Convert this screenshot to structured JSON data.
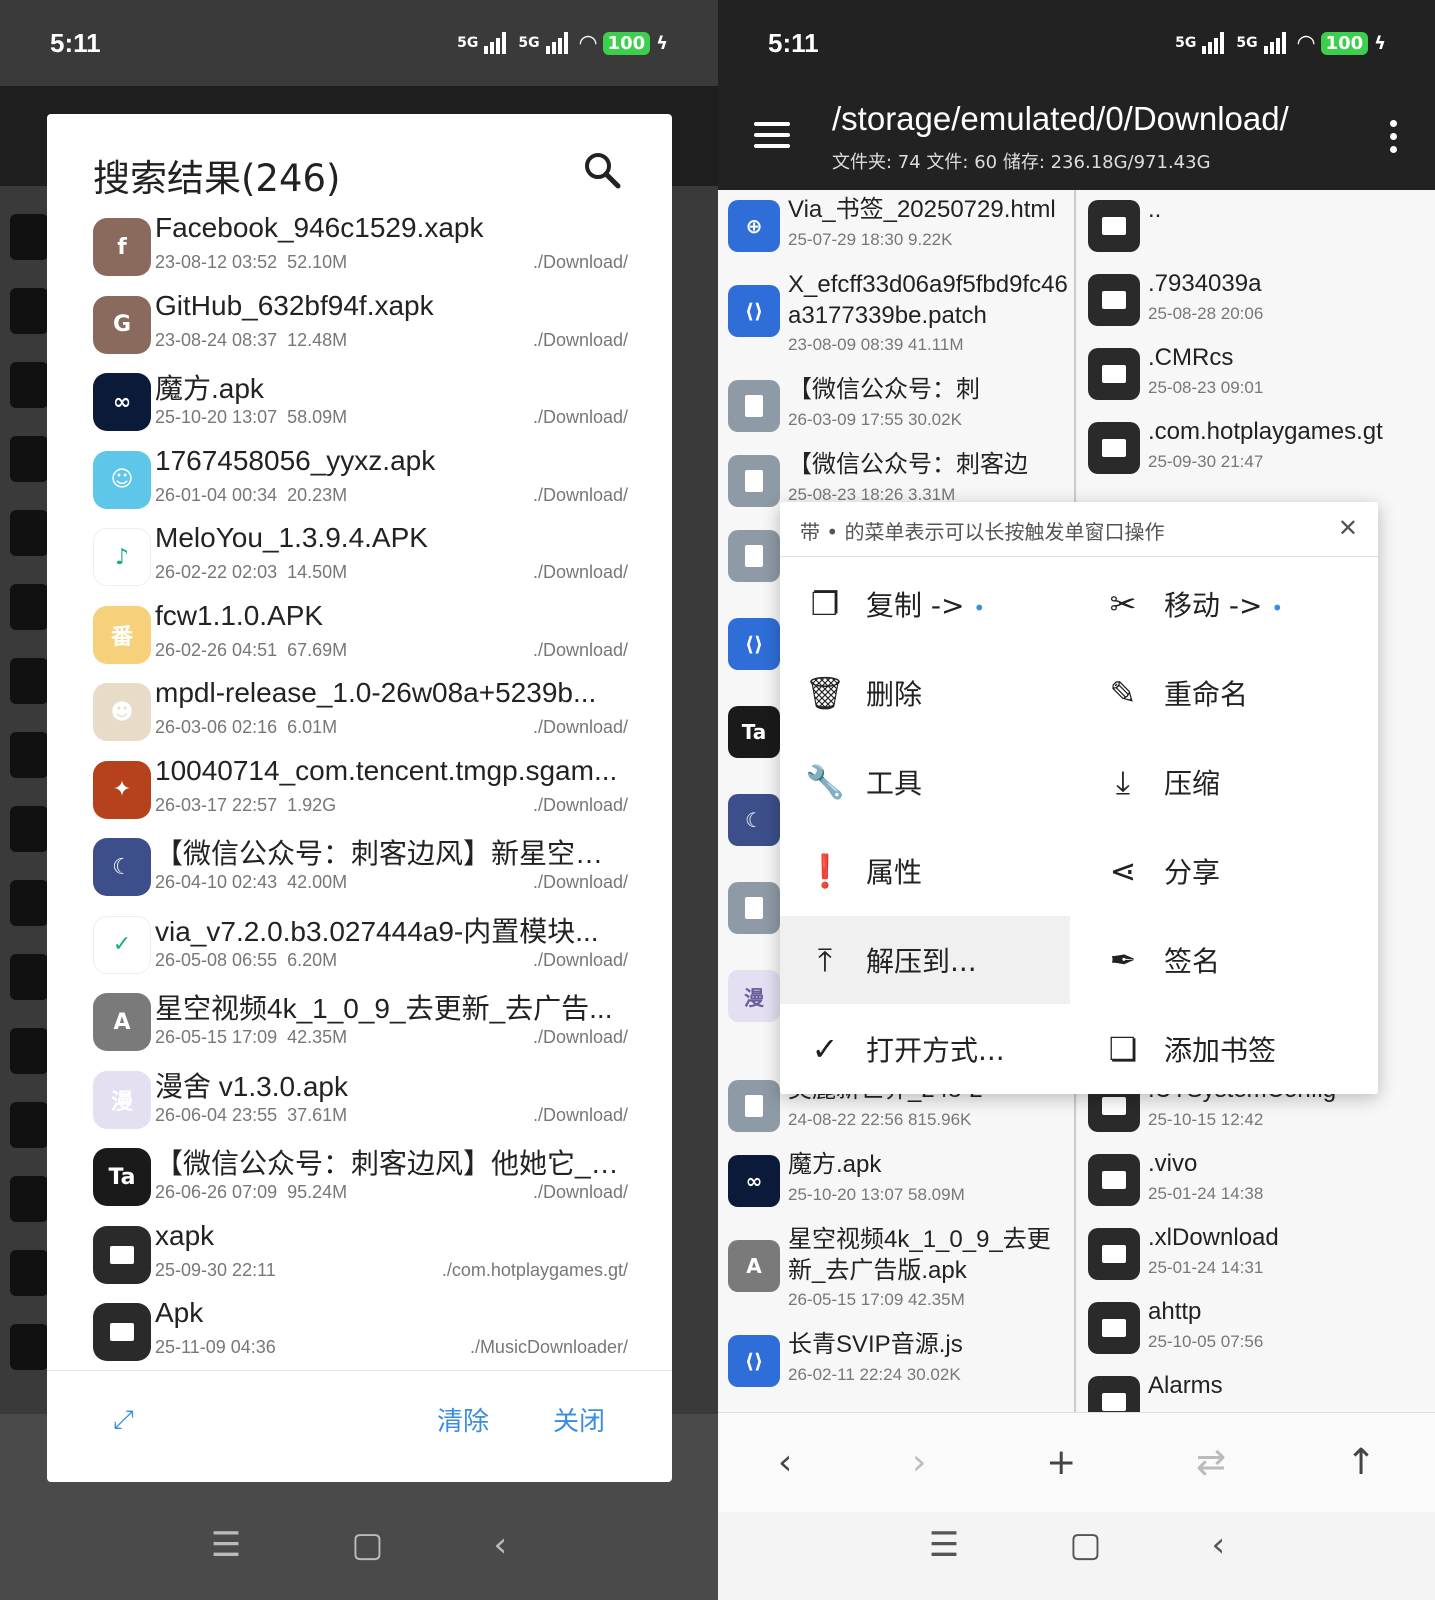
{
  "status": {
    "time": "5:11",
    "net1": "5G",
    "net2": "5G",
    "battery": "100"
  },
  "left": {
    "dialog": {
      "title": "搜索结果(246)",
      "items": [
        {
          "name": "Facebook_946c1529.xapk",
          "date": "23-08-12 03:52",
          "size": "52.10M",
          "path": "./Download/",
          "icon": "android-facebook-icon",
          "color": "#8b6a5e",
          "glyph": "f"
        },
        {
          "name": "GitHub_632bf94f.xapk",
          "date": "23-08-24 08:37",
          "size": "12.48M",
          "path": "./Download/",
          "icon": "android-github-icon",
          "color": "#8b6a5e",
          "glyph": "G"
        },
        {
          "name": "魔方.apk",
          "date": "25-10-20 13:07",
          "size": "58.09M",
          "path": "./Download/",
          "icon": "mofang-icon",
          "color": "#0c1a3a",
          "glyph": "∞"
        },
        {
          "name": "1767458056_yyxz.apk",
          "date": "26-01-04 00:34",
          "size": "20.23M",
          "path": "./Download/",
          "icon": "octopus-icon",
          "color": "#5ec6e8",
          "glyph": "☺"
        },
        {
          "name": "MeloYou_1.3.9.4.APK",
          "date": "26-02-22 02:03",
          "size": "14.50M",
          "path": "./Download/",
          "icon": "music-note-icon",
          "color": "#ffffff",
          "glyph": "♪"
        },
        {
          "name": "fcw1.1.0.APK",
          "date": "26-02-26 04:51",
          "size": "67.69M",
          "path": "./Download/",
          "icon": "fanqie-icon",
          "color": "#f6d07a",
          "glyph": "番"
        },
        {
          "name": "mpdl-release_1.0-26w08a+5239b...",
          "date": "26-03-06 02:16",
          "size": "6.01M",
          "path": "./Download/",
          "icon": "anime-girl-icon",
          "color": "#e8dcc8",
          "glyph": "☻"
        },
        {
          "name": "10040714_com.tencent.tmgp.sgam...",
          "date": "26-03-17 22:57",
          "size": "1.92G",
          "path": "./Download/",
          "icon": "game-hero-icon",
          "color": "#b5421d",
          "glyph": "✦"
        },
        {
          "name": "【微信公众号：刺客边风】新星空动...",
          "date": "26-04-10 02:43",
          "size": "42.00M",
          "path": "./Download/",
          "icon": "anime-portrait-icon",
          "color": "#3c4f8a",
          "glyph": "☾"
        },
        {
          "name": "via_v7.2.0.b3.027444a9-内置模块...",
          "date": "26-05-08 06:55",
          "size": "6.20M",
          "path": "./Download/",
          "icon": "via-browser-icon",
          "color": "#ffffff",
          "glyph": "✓"
        },
        {
          "name": "星空视频4k_1_0_9_去更新_去广告...",
          "date": "26-05-15 17:09",
          "size": "42.35M",
          "path": "./Download/",
          "icon": "android-icon",
          "color": "#7a7a7a",
          "glyph": "A"
        },
        {
          "name": "漫舍 v1.3.0.apk",
          "date": "26-06-04 23:55",
          "size": "37.61M",
          "path": "./Download/",
          "icon": "manshe-icon",
          "color": "#e4e0f2",
          "glyph": "漫"
        },
        {
          "name": "【微信公众号：刺客边风】他她它_1....",
          "date": "26-06-26 07:09",
          "size": "95.24M",
          "path": "./Download/",
          "icon": "ta-app-icon",
          "color": "#1a1a1a",
          "glyph": "Ta"
        },
        {
          "name": "xapk",
          "date": "25-09-30 22:11",
          "size": "",
          "path": "./com.hotplaygames.gt/",
          "icon": "folder-icon",
          "color": "#2a2a2a",
          "glyph": ""
        },
        {
          "name": "Apk",
          "date": "25-11-09 04:36",
          "size": "",
          "path": "./MusicDownloader/",
          "icon": "folder-icon",
          "color": "#2a2a2a",
          "glyph": ""
        }
      ],
      "clear_label": "清除",
      "close_label": "关闭"
    }
  },
  "right": {
    "path": "/storage/emulated/0/Download/",
    "stats": "文件夹: 74  文件: 60  储存: 236.18G/971.43G",
    "col_a": [
      {
        "name": "Via_书签_20250729.html",
        "meta": "25-07-29 18:30  9.22K",
        "kind": "globe"
      },
      {
        "name": "X_efcff33d06a9f5fbd9fc46a3177339be.patch",
        "meta": "23-08-09 08:39  41.11M",
        "kind": "code"
      },
      {
        "name": "【微信公众号：刺",
        "meta": "26-03-09 17:55  30.02K",
        "kind": "doc"
      },
      {
        "name": "【微信公众号：刺客边",
        "meta": "25-08-23 18:26  3.31M",
        "kind": "doc"
      }
    ],
    "col_a_bottom": [
      {
        "name": "美麗新世界_248-2",
        "meta": "24-08-22 22:56  815.96K",
        "kind": "doc"
      },
      {
        "name": "魔方.apk",
        "meta": "25-10-20 13:07  58.09M",
        "kind": "mofang"
      },
      {
        "name": "星空视频4k_1_0_9_去更新_去广告版.apk",
        "meta": "26-05-15 17:09  42.35M",
        "kind": "android"
      },
      {
        "name": "长青SVIP音源.js",
        "meta": "26-02-11 22:24  30.02K",
        "kind": "code"
      }
    ],
    "col_b": [
      {
        "name": "..",
        "meta": ""
      },
      {
        "name": ".7934039a",
        "meta": "25-08-28 20:06"
      },
      {
        "name": ".CMRcs",
        "meta": "25-08-23 09:01"
      },
      {
        "name": ".com.hotplaygames.gt",
        "meta": "25-09-30 21:47"
      }
    ],
    "col_b_bottom": [
      {
        "name": ".UTSystemConfig",
        "meta": "25-10-15 12:42"
      },
      {
        "name": ".vivo",
        "meta": "25-01-24 14:38"
      },
      {
        "name": ".xlDownload",
        "meta": "25-01-24 14:31"
      },
      {
        "name": "ahttp",
        "meta": "25-10-05 07:56"
      },
      {
        "name": "Alarms",
        "meta": ""
      }
    ],
    "popup": {
      "hint": "带 • 的菜单表示可以长按触发单窗口操作",
      "items": [
        {
          "label": "复制 ->",
          "dot": "•",
          "icon": "copy-icon",
          "glyph": "❐"
        },
        {
          "label": "移动 ->",
          "dot": "•",
          "icon": "scissors-icon",
          "glyph": "✂"
        },
        {
          "label": "删除",
          "dot": "",
          "icon": "trash-icon",
          "glyph": "🗑"
        },
        {
          "label": "重命名",
          "dot": "",
          "icon": "pencil-icon",
          "glyph": "✎"
        },
        {
          "label": "工具",
          "dot": "",
          "icon": "wrench-icon",
          "glyph": "🔧"
        },
        {
          "label": "压缩",
          "dot": "",
          "icon": "download-arrow-icon",
          "glyph": "⤓"
        },
        {
          "label": "属性",
          "dot": "",
          "icon": "info-icon",
          "glyph": "❗"
        },
        {
          "label": "分享",
          "dot": "",
          "icon": "share-icon",
          "glyph": "⋖"
        },
        {
          "label": "解压到...",
          "dot": "",
          "icon": "upload-arrow-icon",
          "glyph": "⤒"
        },
        {
          "label": "签名",
          "dot": "",
          "icon": "signature-icon",
          "glyph": "✒"
        },
        {
          "label": "打开方式...",
          "dot": "",
          "icon": "check-icon",
          "glyph": "✓"
        },
        {
          "label": "添加书签",
          "dot": "",
          "icon": "bookmark-icon",
          "glyph": "❏"
        }
      ]
    }
  }
}
